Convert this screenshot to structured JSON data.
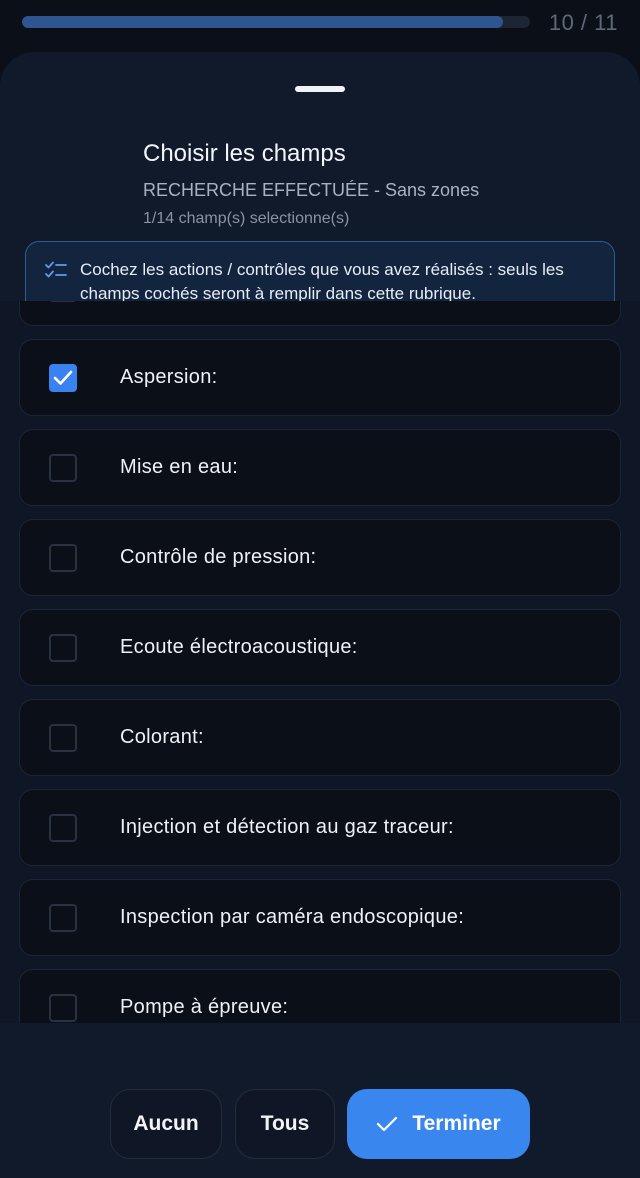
{
  "progress": {
    "fraction": 0.947,
    "count_text": "10 / 11"
  },
  "header": {
    "title": "Choisir les champs",
    "subtitle": "RECHERCHE EFFECTUÉE - Sans zones",
    "selected_count": "1/14 champ(s) selectionne(s)"
  },
  "info": {
    "icon": "checklist-icon",
    "text": "Cochez les actions / contrôles que vous avez réalisés : seuls les champs cochés seront à remplir dans cette rubrique."
  },
  "fields": [
    {
      "label": "",
      "checked": false
    },
    {
      "label": "Aspersion:",
      "checked": true
    },
    {
      "label": "Mise en eau:",
      "checked": false
    },
    {
      "label": "Contrôle de pression:",
      "checked": false
    },
    {
      "label": "Ecoute électroacoustique:",
      "checked": false
    },
    {
      "label": "Colorant:",
      "checked": false
    },
    {
      "label": "Injection et détection au gaz traceur:",
      "checked": false
    },
    {
      "label": "Inspection par caméra endoscopique:",
      "checked": false
    },
    {
      "label": "Pompe à épreuve:",
      "checked": false
    }
  ],
  "footer": {
    "none_label": "Aucun",
    "all_label": "Tous",
    "finish_label": "Terminer",
    "finish_icon": "check-icon"
  },
  "colors": {
    "accent": "#3a86ef",
    "background": "#111a2b",
    "card": "#0b0f17",
    "info_border": "#2b5d96"
  }
}
